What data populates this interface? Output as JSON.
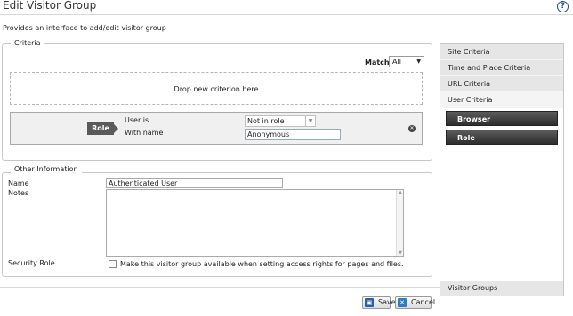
{
  "page": {
    "title": "Edit Visitor Group",
    "description": "Provides an interface to add/edit visitor group"
  },
  "criteria": {
    "legend": "Criteria",
    "match_label": "Match",
    "match_value": "All",
    "drop_text": "Drop new criterion here",
    "criterion": {
      "badge": "Role",
      "user_is_label": "User is",
      "with_name_label": "With name",
      "condition_value": "Not in role",
      "name_value": "Anonymous"
    }
  },
  "other": {
    "legend": "Other Information",
    "name_label": "Name",
    "name_value": "Authenticated User",
    "notes_label": "Notes",
    "notes_value": "",
    "security_label": "Security Role",
    "security_checkbox_label": "Make this visitor group available when setting access rights for pages and files.",
    "security_checked": false
  },
  "sidebar": {
    "sections": [
      {
        "label": "Site Criteria"
      },
      {
        "label": "Time and Place Criteria"
      },
      {
        "label": "URL Criteria"
      },
      {
        "label": "User Criteria",
        "expanded": true,
        "items": [
          {
            "label": "Browser"
          },
          {
            "label": "Role"
          }
        ]
      },
      {
        "label": "Visitor Groups"
      }
    ]
  },
  "footer": {
    "save_label": "Save",
    "cancel_label": "Cancel"
  },
  "colors": {
    "accent": "#1e4e8c",
    "dark_button": "#3a3a3a",
    "panel_bg": "#f4f4f4"
  },
  "icons": [
    "help-icon",
    "remove-icon",
    "save-icon",
    "cancel-icon",
    "dropdown-arrow-icon"
  ]
}
